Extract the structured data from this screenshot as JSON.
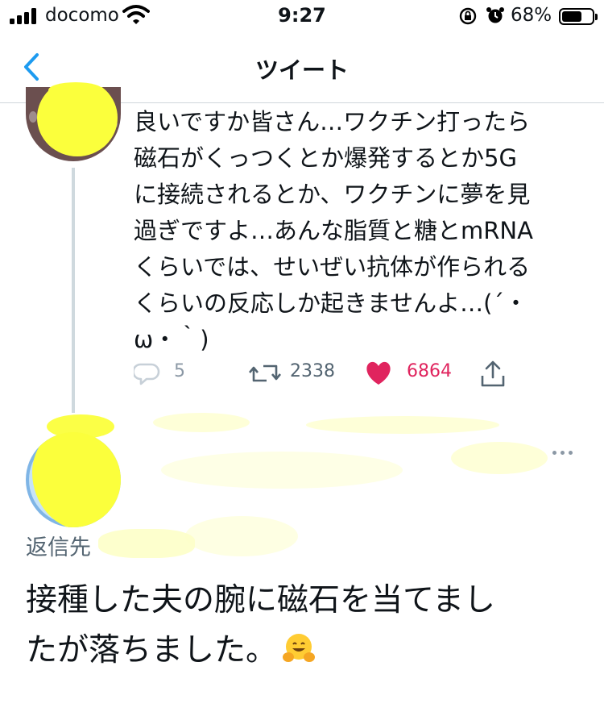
{
  "status_bar": {
    "carrier": "docomo",
    "time": "9:27",
    "battery": "68%",
    "battery_level": 0.68,
    "icons": [
      "signal-icon",
      "wifi-icon",
      "rotation-lock-icon",
      "alarm-icon",
      "battery-icon"
    ]
  },
  "nav": {
    "back_icon": "chevron-left-icon",
    "title": "ツイート"
  },
  "tweet": {
    "avatar": "redacted-avatar",
    "lines": [
      "良いですか皆さん…ワクチン打ったら",
      "磁石がくっつくとか爆発するとか5G",
      "に接続されるとか、ワクチンに夢を見",
      "過ぎですよ…あんな脂質と糖とmRNA",
      "くらいでは、せいぜい抗体が作られる",
      "くらいの反応しか起きませんよ…(´・",
      "ω・｀)"
    ],
    "replies": "5",
    "retweets": "2338",
    "likes": "6864",
    "colors": {
      "like": "#e0245e",
      "muted": "#536471"
    }
  },
  "reply": {
    "avatar": "redacted-avatar",
    "reply_to_label": "返信先",
    "lines": [
      "接種した夫の腕に磁石を当てまし",
      "たが落ちました。"
    ],
    "emoji": "hugging-face-emoji"
  }
}
